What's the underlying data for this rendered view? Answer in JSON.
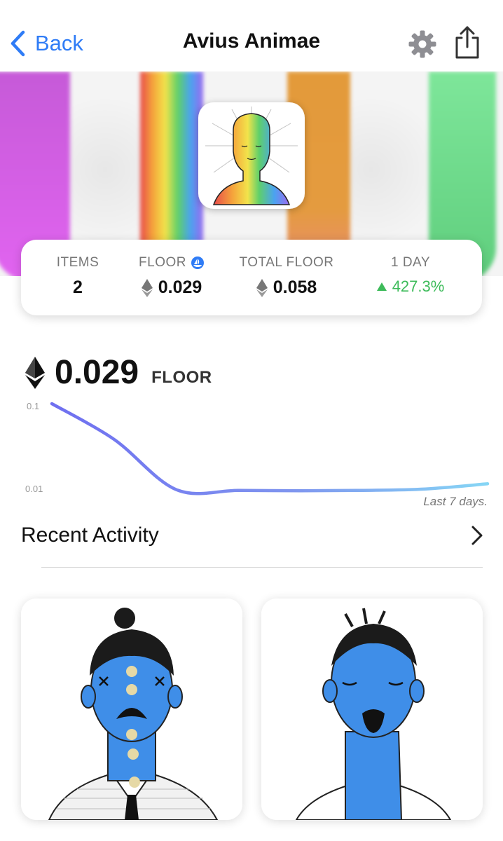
{
  "header": {
    "back_label": "Back",
    "title": "Avius Animae",
    "icons": [
      "chevron-left-icon",
      "gear-icon",
      "share-icon"
    ]
  },
  "stats": {
    "items_label": "ITEMS",
    "items_value": "2",
    "floor_label": "FLOOR",
    "floor_value": "0.029",
    "total_floor_label": "TOTAL FLOOR",
    "total_floor_value": "0.058",
    "day_label": "1 DAY",
    "day_change": "427.3%"
  },
  "price": {
    "value": "0.029",
    "unit": "FLOOR"
  },
  "chart_data": {
    "type": "line",
    "title": "",
    "xlabel": "",
    "ylabel": "",
    "y_scale": "log",
    "ytick_labels": [
      "0.1",
      "0.01"
    ],
    "ylim": [
      0.01,
      0.1
    ],
    "x": [
      0,
      1,
      2,
      3,
      4,
      5,
      6,
      7
    ],
    "series": [
      {
        "values": [
          0.1,
          0.04,
          0.011,
          0.0108,
          0.0107,
          0.0108,
          0.0112,
          0.0128
        ]
      }
    ],
    "caption": "Last 7 days.",
    "colors": {
      "start": "#6f6ff0",
      "end": "#86d6f5"
    }
  },
  "recent": {
    "label": "Recent Activity"
  },
  "colors": {
    "accent": "#2f7cf6",
    "positive": "#3dbb5a",
    "nft_blue": "#3f8ee8"
  }
}
